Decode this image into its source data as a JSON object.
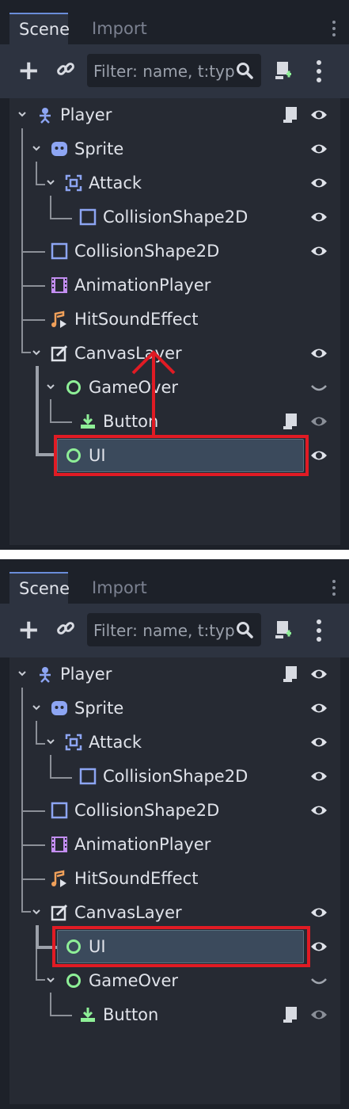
{
  "panels": [
    {
      "tabs": {
        "scene": "Scene",
        "import": "Import"
      },
      "filter_placeholder": "Filter: name, t:typ",
      "nodes": {
        "player": "Player",
        "sprite": "Sprite",
        "attack": "Attack",
        "attack_collision": "CollisionShape2D",
        "collision": "CollisionShape2D",
        "animation_player": "AnimationPlayer",
        "hit_sound": "HitSoundEffect",
        "canvas_layer": "CanvasLayer",
        "game_over": "GameOver",
        "button": "Button",
        "ui": "UI"
      }
    },
    {
      "tabs": {
        "scene": "Scene",
        "import": "Import"
      },
      "filter_placeholder": "Filter: name, t:typ",
      "nodes": {
        "player": "Player",
        "sprite": "Sprite",
        "attack": "Attack",
        "attack_collision": "CollisionShape2D",
        "collision": "CollisionShape2D",
        "animation_player": "AnimationPlayer",
        "hit_sound": "HitSoundEffect",
        "canvas_layer": "CanvasLayer",
        "ui": "UI",
        "game_over": "GameOver",
        "button": "Button"
      }
    }
  ],
  "colors": {
    "panel_bg": "#1d2129",
    "tree_bg": "#262a33",
    "toolbar_bg": "#2d3340",
    "selection_bg": "#3b4a5c",
    "highlight_red": "#e01b24",
    "node_2d_blue": "#8da5f3",
    "control_green": "#8eef97",
    "animation_purple": "#c38ef1",
    "audio_orange": "#f0a05a"
  },
  "icons": [
    "add-node-icon",
    "link-icon",
    "search-icon",
    "attach-script-icon",
    "menu-icon",
    "eye-icon",
    "script-icon",
    "visibility-hidden-icon",
    "collapse-arrow-icon"
  ]
}
